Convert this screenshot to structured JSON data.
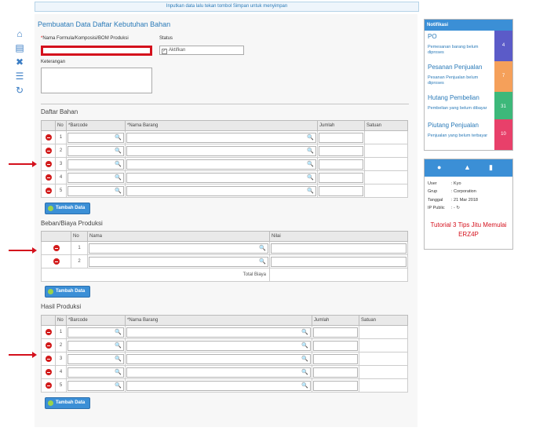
{
  "top_message": "Inputkan data lalu tekan tombol Simpan untuk menyimpan",
  "page_title": "Pembuatan Data Daftar Kebutuhan Bahan",
  "form": {
    "name_label": "Nama Formula/Komposisi/BOM Produksi",
    "required_mark": "*",
    "status_label": "Status",
    "status_option": "Aktifkan",
    "keterangan_label": "Keterangan"
  },
  "icons": {
    "home": "⌂",
    "save": "▤",
    "close": "✖",
    "list": "☰",
    "refresh": "↻",
    "search": "🔍",
    "user": "●",
    "bell": "▲",
    "doc": "▮",
    "refresh_small": "↻"
  },
  "daftar_bahan": {
    "title": "Daftar Bahan",
    "headers": [
      "",
      "No",
      "*Barcode",
      "*Nama Barang",
      "Jumlah",
      "Satuan"
    ],
    "rows": [
      "1",
      "2",
      "3",
      "4",
      "5"
    ]
  },
  "beban": {
    "title": "Beban/Biaya Produksi",
    "headers": [
      "",
      "No",
      "Nama",
      "Nilai"
    ],
    "rows": [
      "1",
      "2"
    ],
    "total_label": "Total Biaya"
  },
  "hasil": {
    "title": "Hasil Produksi",
    "headers": [
      "",
      "No",
      "*Barcode",
      "*Nama Barang",
      "Jumlah",
      "Satuan"
    ],
    "rows": [
      "1",
      "2",
      "3",
      "4",
      "5"
    ]
  },
  "add_button_label": "Tambah Data",
  "notifikasi": {
    "title": "Notifikasi",
    "items": [
      {
        "title": "PO",
        "desc": "Pemesanan barang belum diproses",
        "count": "4",
        "color": "#5b5bc8"
      },
      {
        "title": "Pesanan Penjualan",
        "desc": "Pesanan Penjualan belum diproses",
        "count": "7",
        "color": "#f5a05a"
      },
      {
        "title": "Hutang Pembelian",
        "desc": "Pembelian yang belum dibayar",
        "count": "31",
        "color": "#3db87a"
      },
      {
        "title": "Piutang Penjualan",
        "desc": "Penjualan yang belum terbayar",
        "count": "10",
        "color": "#e8406a"
      }
    ]
  },
  "user_info": {
    "user_label": "User",
    "user_value": ": Kyo",
    "grup_label": "Grup",
    "grup_value": ": Corporation",
    "tanggal_label": "Tanggal",
    "tanggal_value": ": 21 Mar 2018",
    "ip_label": "IP Public",
    "ip_value": ": -",
    "tips": "Tutorial 3 Tips Jitu Memulai ERZ4P"
  }
}
